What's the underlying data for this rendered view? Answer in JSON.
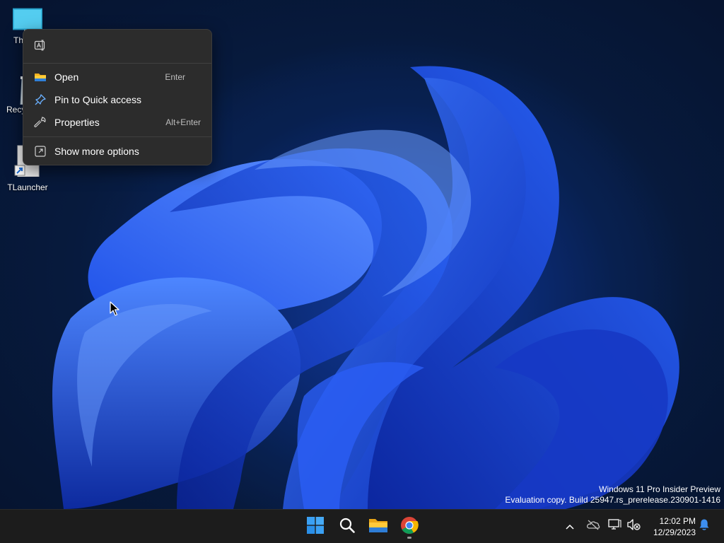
{
  "desktop": {
    "icons": [
      {
        "label": "Th",
        "icon": "this-pc-icon"
      },
      {
        "label": "Recy",
        "icon": "recycle-bin-icon"
      },
      {
        "label": "TLauncher",
        "icon": "shortcut-icon"
      }
    ]
  },
  "context_menu": {
    "quick_actions": [
      {
        "icon": "rename-icon"
      }
    ],
    "items": [
      {
        "label": "Open",
        "shortcut": "Enter",
        "icon": "folder-icon"
      },
      {
        "label": "Pin to Quick access",
        "shortcut": "",
        "icon": "pin-icon"
      },
      {
        "label": "Properties",
        "shortcut": "Alt+Enter",
        "icon": "wrench-icon"
      }
    ],
    "more": {
      "label": "Show more options",
      "icon": "show-more-icon"
    }
  },
  "watermark": {
    "line1": "Windows 11 Pro Insider Preview",
    "line2": "Evaluation copy. Build 25947.rs_prerelease.230901-1416"
  },
  "taskbar": {
    "apps": [
      {
        "name": "start",
        "icon": "windows-logo-icon"
      },
      {
        "name": "search",
        "icon": "search-icon"
      },
      {
        "name": "file-explorer",
        "icon": "folder-icon"
      },
      {
        "name": "chrome",
        "icon": "chrome-icon"
      }
    ],
    "tray_icons": [
      "chevron-up-icon",
      "onedrive-icon",
      "network-icon",
      "volume-muted-icon",
      "notification-bell-icon"
    ],
    "time": "12:02 PM",
    "date": "12/29/2023"
  },
  "colors": {
    "menu_bg": "#2c2c2c",
    "taskbar_bg": "#1c1c1c",
    "accent": "#2b7bf5"
  }
}
